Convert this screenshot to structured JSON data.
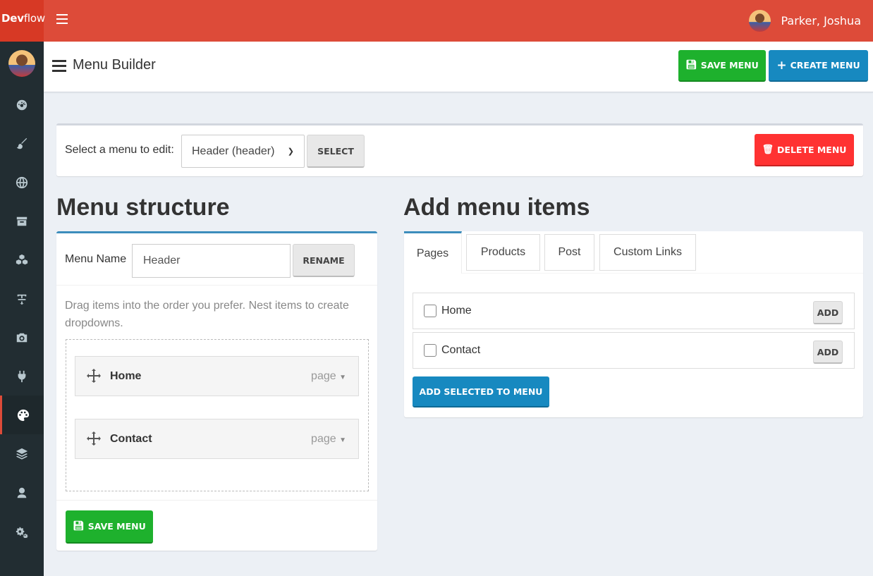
{
  "brand": {
    "bold": "Dev",
    "light": "flow"
  },
  "user": {
    "name": "Parker, Joshua"
  },
  "sidebar": {
    "items": [
      {
        "icon": "dashboard-icon"
      },
      {
        "icon": "brush-icon"
      },
      {
        "icon": "globe-icon"
      },
      {
        "icon": "archive-icon"
      },
      {
        "icon": "cubes-icon"
      },
      {
        "icon": "text-height-icon"
      },
      {
        "icon": "camera-icon"
      },
      {
        "icon": "plug-icon"
      },
      {
        "icon": "palette-icon",
        "active": true
      },
      {
        "icon": "layers-icon"
      },
      {
        "icon": "user-icon"
      },
      {
        "icon": "cogs-icon"
      }
    ]
  },
  "header": {
    "title": "Menu Builder",
    "save_label": "SAVE MENU",
    "create_label": "CREATE MENU"
  },
  "select_bar": {
    "label": "Select a menu to edit:",
    "selected": "Header (header)",
    "select_label": "SELECT",
    "delete_label": "DELETE MENU"
  },
  "structure": {
    "heading": "Menu structure",
    "name_label": "Menu Name",
    "name_value": "Header",
    "rename_label": "RENAME",
    "hint": "Drag items into the order you prefer. Nest items to create dropdowns.",
    "items": [
      {
        "title": "Home",
        "type": "page"
      },
      {
        "title": "Contact",
        "type": "page"
      }
    ],
    "save_label": "SAVE MENU"
  },
  "add_items": {
    "heading": "Add menu items",
    "tabs": [
      {
        "label": "Pages",
        "active": true
      },
      {
        "label": "Products"
      },
      {
        "label": "Post"
      },
      {
        "label": "Custom Links"
      }
    ],
    "pages": [
      {
        "label": "Home",
        "add_label": "ADD"
      },
      {
        "label": "Contact",
        "add_label": "ADD"
      }
    ],
    "add_selected_label": "ADD SELECTED TO MENU"
  },
  "colors": {
    "topbar": "#dd4b39",
    "sidebar": "#222d32",
    "green": "#1eb12d",
    "blue": "#1789c0",
    "red": "#ff3232",
    "accent_blue": "#3c8dbc"
  }
}
